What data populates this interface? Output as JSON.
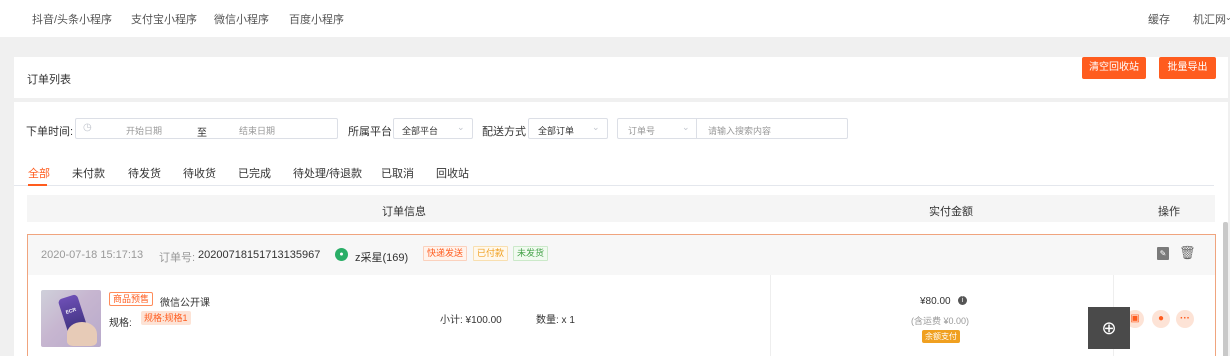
{
  "topnav": {
    "items": [
      "抖音/头条小程序",
      "支付宝小程序",
      "微信小程序",
      "百度小程序"
    ],
    "right": [
      "缓存",
      "机汇网"
    ]
  },
  "header": {
    "title": "订单列表",
    "clear_recycle_label": "清空回收站",
    "export_label": "批量导出"
  },
  "filters": {
    "order_time_label": "下单时间:",
    "start_placeholder": "开始日期",
    "to_label": "至",
    "end_placeholder": "结束日期",
    "platform_label": "所属平台",
    "platform_value": "全部平台",
    "delivery_label": "配送方式",
    "delivery_value": "全部订单",
    "search_field_value": "订单号",
    "search_placeholder": "请输入搜索内容"
  },
  "tabs": [
    "全部",
    "未付款",
    "待发货",
    "待收货",
    "已完成",
    "待处理/待退款",
    "已取消",
    "回收站"
  ],
  "table": {
    "col_order_info": "订单信息",
    "col_amount": "实付金额",
    "col_actions": "操作"
  },
  "order": {
    "time": "2020-07-18 15:17:13",
    "order_no_label": "订单号:",
    "order_no": "20200718151713135967",
    "user": "z采星(169)",
    "tags": [
      "快递发送",
      "已付款",
      "未发货"
    ],
    "product_tag": "商品预售",
    "product_name": "微信公开课",
    "spec_label": "规格:",
    "spec_value": "规格:规格1",
    "subtotal": "小计: ¥100.00",
    "quantity": "数量: x 1",
    "paid_amount": "¥80.00",
    "shipping_note": "(含运费 ¥0.00)",
    "pay_method": "余额支付",
    "thumb_text": "ECR"
  },
  "colors": {
    "accent": "#ff5c1e",
    "wechat_green": "#2aae67"
  }
}
